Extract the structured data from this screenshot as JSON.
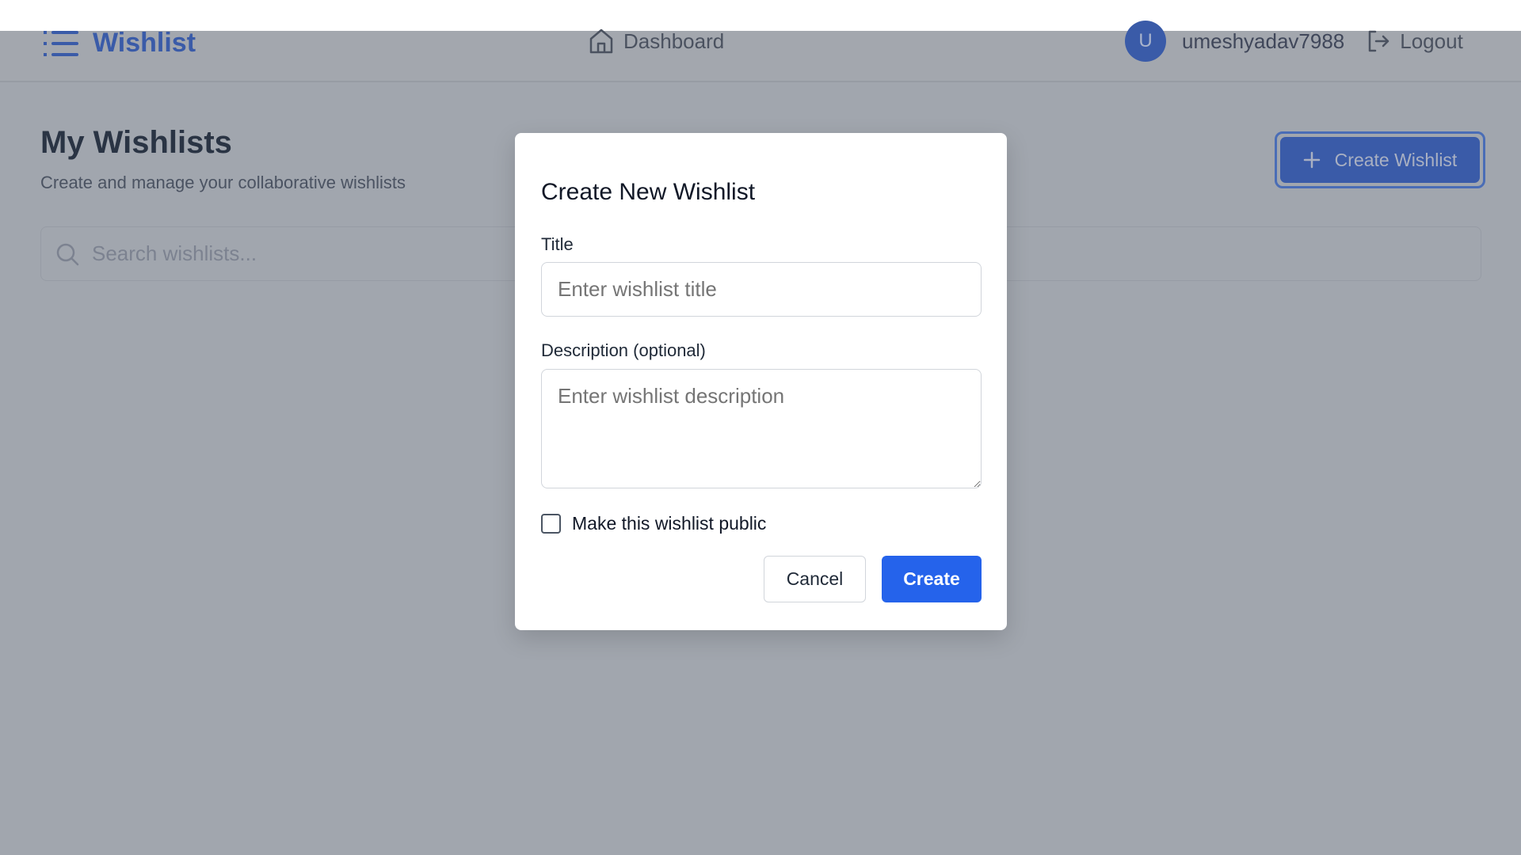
{
  "header": {
    "brand": "Wishlist",
    "nav_dashboard": "Dashboard",
    "avatar_initial": "U",
    "username": "umeshyadav7988",
    "logout": "Logout"
  },
  "page": {
    "title": "My Wishlists",
    "subtitle": "Create and manage your collaborative wishlists",
    "create_button": "Create Wishlist",
    "search_placeholder": "Search wishlists..."
  },
  "modal": {
    "title": "Create New Wishlist",
    "title_label": "Title",
    "title_placeholder": "Enter wishlist title",
    "description_label": "Description (optional)",
    "description_placeholder": "Enter wishlist description",
    "public_label": "Make this wishlist public",
    "public_checked": false,
    "cancel": "Cancel",
    "create": "Create"
  },
  "colors": {
    "accent": "#2563eb",
    "overlay": "#a1a6ae"
  }
}
